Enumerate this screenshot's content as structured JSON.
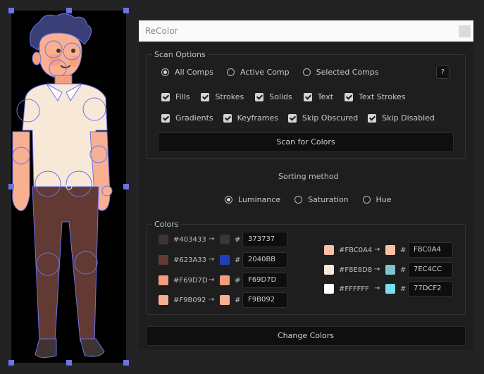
{
  "panel": {
    "title": "ReColor",
    "help_label": "?"
  },
  "scan_options": {
    "label": "Scan Options",
    "radios": [
      {
        "label": "All Comps",
        "selected": true
      },
      {
        "label": "Active Comp",
        "selected": false
      },
      {
        "label": "Selected Comps",
        "selected": false
      }
    ],
    "checks_row1": [
      {
        "label": "Fills",
        "checked": true
      },
      {
        "label": "Strokes",
        "checked": true
      },
      {
        "label": "Solids",
        "checked": true
      },
      {
        "label": "Text",
        "checked": true
      },
      {
        "label": "Text Strokes",
        "checked": true
      }
    ],
    "checks_row2": [
      {
        "label": "Gradients",
        "checked": true
      },
      {
        "label": "Keyframes",
        "checked": true
      },
      {
        "label": "Skip Obscured",
        "checked": true
      },
      {
        "label": "Skip Disabled",
        "checked": true
      }
    ],
    "scan_button": "Scan for Colors"
  },
  "sorting": {
    "label": "Sorting method",
    "options": [
      {
        "label": "Luminance",
        "selected": true
      },
      {
        "label": "Saturation",
        "selected": false
      },
      {
        "label": "Hue",
        "selected": false
      }
    ]
  },
  "colors": {
    "label": "Colors",
    "arrow": "→",
    "hash": "#",
    "left": [
      {
        "source": "#403433",
        "source_color": "#403433",
        "target": "373737",
        "target_color": "#373737"
      },
      {
        "source": "#623A33",
        "source_color": "#623A33",
        "target": "2040BB",
        "target_color": "#2040BB"
      },
      {
        "source": "#F69D7D",
        "source_color": "#F69D7D",
        "target": "F69D7D",
        "target_color": "#F69D7D"
      },
      {
        "source": "#F9B092",
        "source_color": "#F9B092",
        "target": "F9B092",
        "target_color": "#F9B092"
      }
    ],
    "right": [
      {
        "source": "#FBC0A4",
        "source_color": "#FBC0A4",
        "target": "FBC0A4",
        "target_color": "#FBC0A4"
      },
      {
        "source": "#F8E8D8",
        "source_color": "#F8E8D8",
        "target": "7EC4CC",
        "target_color": "#7EC4CC"
      },
      {
        "source": "#FFFFFF",
        "source_color": "#FFFFFF",
        "target": "77DCF2",
        "target_color": "#77DCF2"
      }
    ]
  },
  "change_button": "Change Colors",
  "theme": {
    "accent": "#6A73E8",
    "panel_bg": "#1E1E1E",
    "app_bg": "#232323"
  }
}
